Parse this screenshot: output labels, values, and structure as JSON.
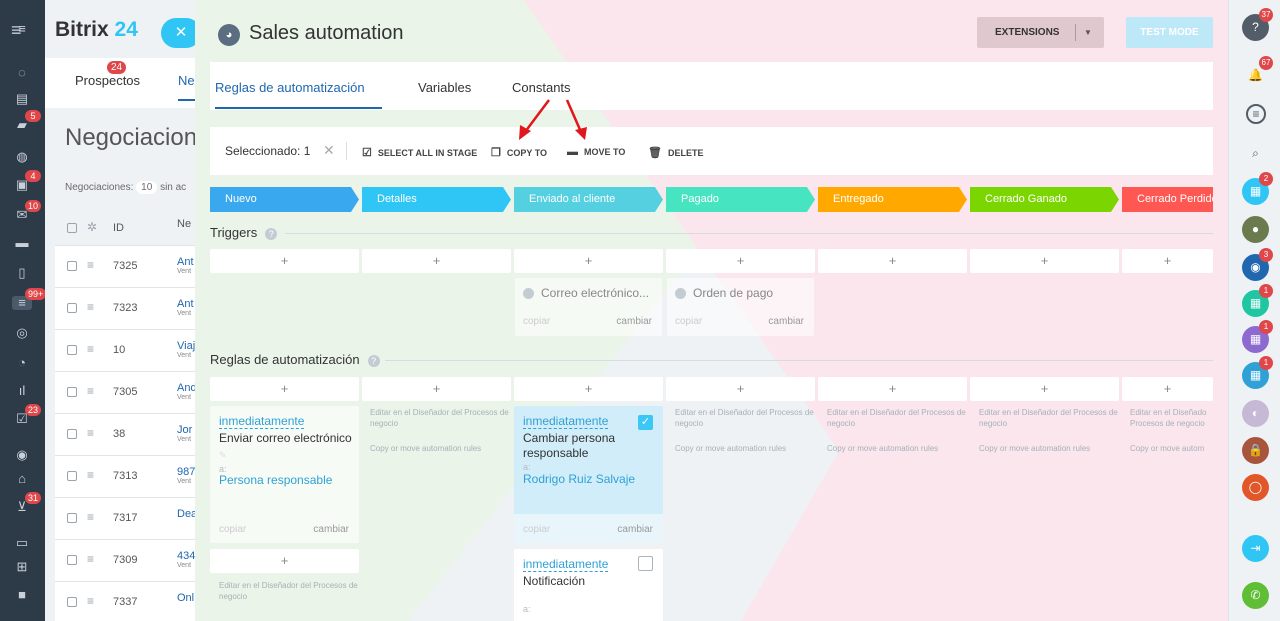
{
  "app": {
    "brand_name": "Bitrix",
    "brand_number": "24"
  },
  "left_sidebar": [
    {
      "icon": "pulse-icon",
      "badge": ""
    },
    {
      "icon": "calendar-icon",
      "badge": ""
    },
    {
      "icon": "chat-icon",
      "badge": "5"
    },
    {
      "icon": "group-icon",
      "badge": ""
    },
    {
      "icon": "tasks-icon",
      "badge": "4"
    },
    {
      "icon": "mail-icon",
      "badge": "10"
    },
    {
      "icon": "drive-icon",
      "badge": ""
    },
    {
      "icon": "document-icon",
      "badge": ""
    },
    {
      "icon": "crm-icon",
      "badge": "99+"
    },
    {
      "icon": "target-icon",
      "badge": ""
    },
    {
      "icon": "timer-icon",
      "badge": ""
    },
    {
      "icon": "analytics-icon",
      "badge": ""
    },
    {
      "icon": "checklist-icon",
      "badge": "23"
    },
    {
      "icon": "robot-icon",
      "badge": ""
    },
    {
      "icon": "shop-icon",
      "badge": ""
    },
    {
      "icon": "cart-icon",
      "badge": "31"
    },
    {
      "icon": "calendar2-icon",
      "badge": ""
    },
    {
      "icon": "apps-icon",
      "badge": ""
    },
    {
      "icon": "video-icon",
      "badge": ""
    }
  ],
  "bg_page": {
    "tab1": "Prospectos",
    "tab1_badge": "24",
    "tab2": "Ne",
    "title": "Negociaciones",
    "count_label": "Negociaciones:",
    "count_value": "10",
    "count_suffix": "sin ac",
    "id_header": "ID",
    "name_header": "Ne",
    "rows": [
      {
        "id": "7325",
        "name": "Ant",
        "sub": "Vent"
      },
      {
        "id": "7323",
        "name": "Ant",
        "sub": "Vent"
      },
      {
        "id": "10",
        "name": "Viaj",
        "sub": "Vent"
      },
      {
        "id": "7305",
        "name": "And",
        "sub": "Vent"
      },
      {
        "id": "38",
        "name": "Jor",
        "sub": "Vent"
      },
      {
        "id": "7313",
        "name": "987",
        "sub": "Vent"
      },
      {
        "id": "7317",
        "name": "Dea",
        "sub": ""
      },
      {
        "id": "7309",
        "name": "434",
        "sub": "Vent"
      },
      {
        "id": "7337",
        "name": "Onl",
        "sub": ""
      }
    ]
  },
  "slider": {
    "title": "Sales automation",
    "extensions_label": "EXTENSIONS",
    "test_mode_label": "TEST MODE",
    "tabs": [
      "Reglas de automatización",
      "Variables",
      "Constants"
    ],
    "toolbar": {
      "selected_label": "Seleccionado: 1",
      "select_all": "SELECT ALL IN STAGE",
      "copy_to": "COPY TO",
      "move_to": "MOVE TO",
      "delete": "DELETE"
    },
    "stages": [
      {
        "name": "Nuevo",
        "color": "#39a8ef"
      },
      {
        "name": "Detalles",
        "color": "#2fc6f6"
      },
      {
        "name": "Enviado al cliente",
        "color": "#55d0e0"
      },
      {
        "name": "Pagado",
        "color": "#47e4c2"
      },
      {
        "name": "Entregado",
        "color": "#ffa900"
      },
      {
        "name": "Cerrado Ganado",
        "color": "#7bd500"
      },
      {
        "name": "Cerrado Perdido",
        "color": "#ff5752"
      }
    ],
    "triggers_label": "Triggers",
    "trigger_cards": [
      {
        "label": "Correo electrónico...",
        "copy": "copiar",
        "change": "cambiar"
      },
      {
        "label": "Orden de pago",
        "copy": "copiar",
        "change": "cambiar"
      }
    ],
    "rules_label": "Reglas de automatización",
    "hint_designer": "Editar en el Diseñador del Procesos de negocio",
    "hint_copy": "Copy or move automation rules",
    "hint_designer_cut": "Editar en el Diseñado Procesos de negocio",
    "hint_copy_cut": "Copy or move autom",
    "rule_cards": [
      {
        "when": "inmediatamente",
        "action": "Enviar correo electrónico",
        "to": "a:",
        "who": "Persona responsable",
        "copy": "copiar",
        "change": "cambiar"
      },
      {
        "when": "inmediatamente",
        "action_line1": "Cambiar persona",
        "action_line2": "responsable",
        "to": "a:",
        "who": "Rodrigo Ruiz Salvaje",
        "copy": "copiar",
        "change": "cambiar"
      },
      {
        "when": "inmediatamente",
        "action": "Notificación",
        "to": "a:"
      }
    ],
    "plus": "+",
    "colors": {
      "accent": "#2067b0",
      "link": "#2fa1d6",
      "selected_card": "#d1edf9",
      "checkbox": "#3bc8f5",
      "arrow": "#e0171b"
    }
  },
  "right_sidebar": [
    {
      "icon": "help-icon",
      "badge": "37"
    },
    {
      "icon": "bell-icon",
      "badge": "67"
    },
    {
      "icon": "message-icon",
      "badge": ""
    },
    {
      "icon": "search-icon",
      "badge": ""
    },
    {
      "icon": "calendar-icon",
      "badge": "2"
    },
    {
      "icon": "avatar-icon",
      "badge": ""
    },
    {
      "icon": "group-chat-icon",
      "badge": "3"
    },
    {
      "icon": "calendar-icon",
      "badge": "1"
    },
    {
      "icon": "calendar-icon",
      "badge": "1"
    },
    {
      "icon": "calendar-icon",
      "badge": "1"
    },
    {
      "icon": "avatar-icon",
      "badge": ""
    },
    {
      "icon": "lock-icon",
      "badge": ""
    },
    {
      "icon": "user-icon",
      "badge": ""
    },
    {
      "icon": "exit-icon",
      "badge": ""
    },
    {
      "icon": "phone-icon",
      "badge": ""
    }
  ]
}
